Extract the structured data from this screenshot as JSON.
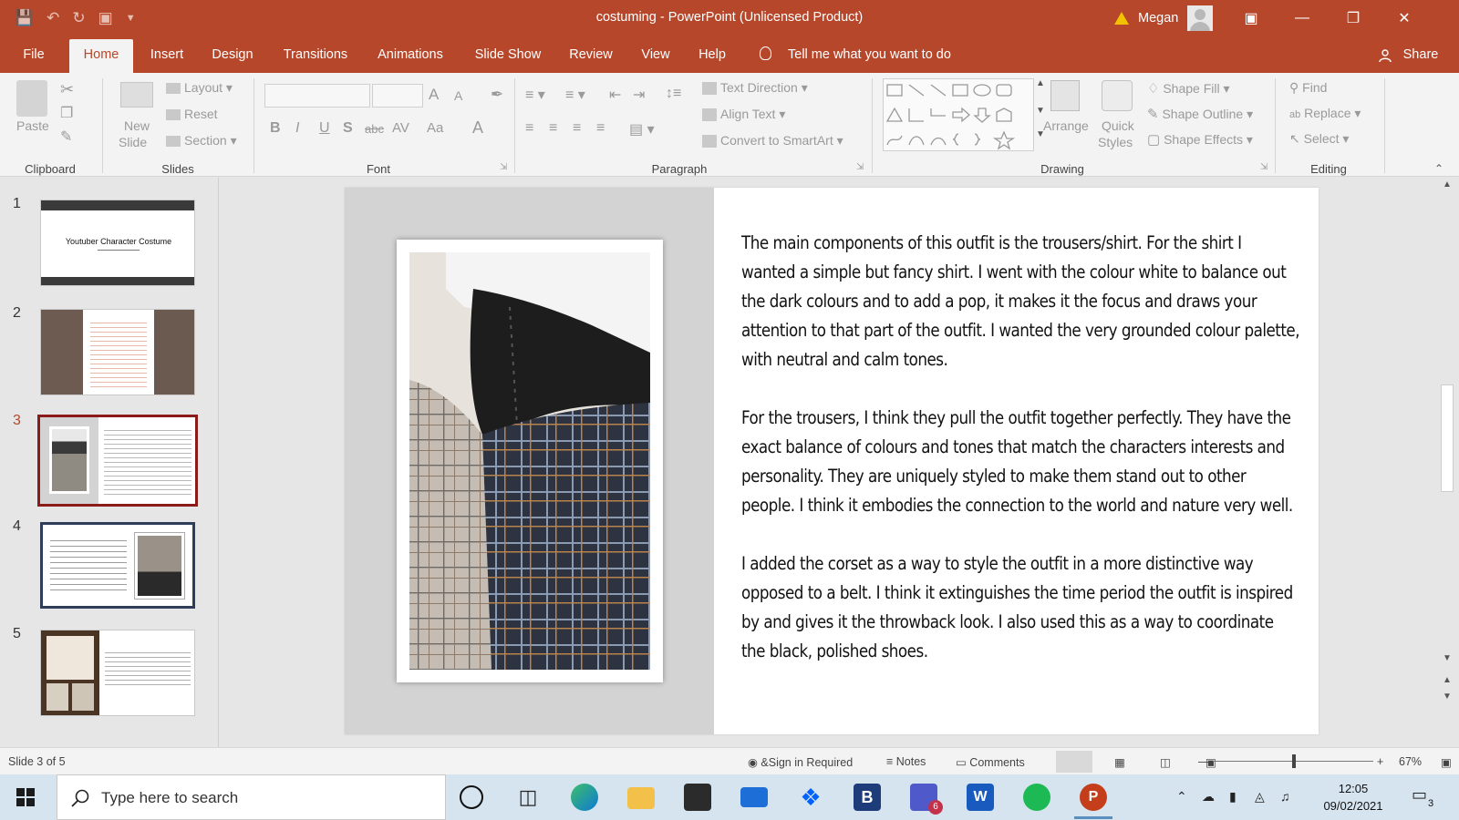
{
  "window": {
    "title": "costuming  -  PowerPoint (Unlicensed Product)",
    "user_name": "Megan"
  },
  "tabs": [
    "File",
    "Home",
    "Insert",
    "Design",
    "Transitions",
    "Animations",
    "Slide Show",
    "Review",
    "View",
    "Help"
  ],
  "active_tab": "Home",
  "tell_me": "Tell me what you want to do",
  "share_label": "Share",
  "ribbon": {
    "clipboard": {
      "label": "Clipboard",
      "paste": "Paste"
    },
    "slides": {
      "label": "Slides",
      "new_slide_1": "New",
      "new_slide_2": "Slide",
      "layout": "Layout",
      "reset": "Reset",
      "section": "Section"
    },
    "font": {
      "label": "Font",
      "bold": "B",
      "italic": "I",
      "underline": "U",
      "shadow": "S",
      "strike": "abc",
      "spacing": "AV",
      "case": "Aa",
      "color": "A",
      "grow": "A",
      "shrink": "A"
    },
    "paragraph": {
      "label": "Paragraph",
      "text_direction": "Text Direction",
      "align_text": "Align Text",
      "convert_smartart": "Convert to SmartArt"
    },
    "drawing": {
      "label": "Drawing",
      "arrange": "Arrange",
      "quick_styles_1": "Quick",
      "quick_styles_2": "Styles",
      "shape_fill": "Shape Fill",
      "shape_outline": "Shape Outline",
      "shape_effects": "Shape Effects"
    },
    "editing": {
      "label": "Editing",
      "find": "Find",
      "replace": "Replace",
      "select": "Select"
    }
  },
  "thumbnails": [
    {
      "num": "1",
      "title": "Youtuber Character Costume"
    },
    {
      "num": "2"
    },
    {
      "num": "3"
    },
    {
      "num": "4"
    },
    {
      "num": "5"
    }
  ],
  "slide": {
    "paragraphs": [
      "The main components of this outfit is the trousers/shirt. For the shirt I wanted a simple but fancy shirt. I went with the colour white to balance out the dark colours and to add a pop, it makes it the focus and draws your attention to that part of the outfit. I wanted the very grounded colour palette, with neutral and calm tones.",
      "For the trousers, I think they pull the outfit together perfectly. They have the exact balance of colours and tones that match the characters interests and personality. They are uniquely styled to make them stand out to other people. I think it embodies the connection to the world and nature very well.",
      "I added the corset as a way to style the outfit in a more distinctive way opposed to a belt. I think it extinguishes the time period the outfit is inspired by and gives it the throwback look. I also used this as a way to coordinate the black, polished shoes."
    ]
  },
  "status": {
    "slide_info": "Slide 3 of 5",
    "sign_in": "&Sign in Required",
    "notes": "Notes",
    "comments": "Comments",
    "zoom": "67%"
  },
  "taskbar": {
    "search_placeholder": "Type here to search",
    "time": "12:05",
    "date": "09/02/2021",
    "teams_badge": "6",
    "notifications": "3"
  },
  "colors": {
    "accent": "#b7472a",
    "selected_thumb": "#8b1a1a"
  }
}
